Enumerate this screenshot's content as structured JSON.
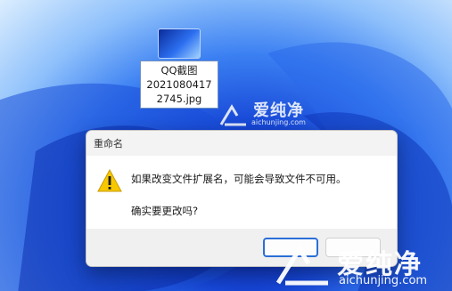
{
  "desktop": {
    "file": {
      "name_line1": "QQ截图",
      "name_line2": "2021080417",
      "name_line3": "2745.jpg",
      "icon": "image-file-thumbnail-icon"
    }
  },
  "dialog": {
    "title": "重命名",
    "message": "如果改变文件扩展名，可能会导致文件不可用。",
    "question": "确实要更改吗?",
    "icon": "warning-icon",
    "buttons": {
      "yes": "",
      "no": ""
    }
  },
  "watermark": {
    "text_cn": "爱纯净",
    "text_en": "aichunjing.com",
    "logo": "aichunjing-logo-icon"
  },
  "colors": {
    "accent": "#2b6fd6",
    "warning": "#f7c800",
    "dialog_bg": "#f3f3f3"
  }
}
